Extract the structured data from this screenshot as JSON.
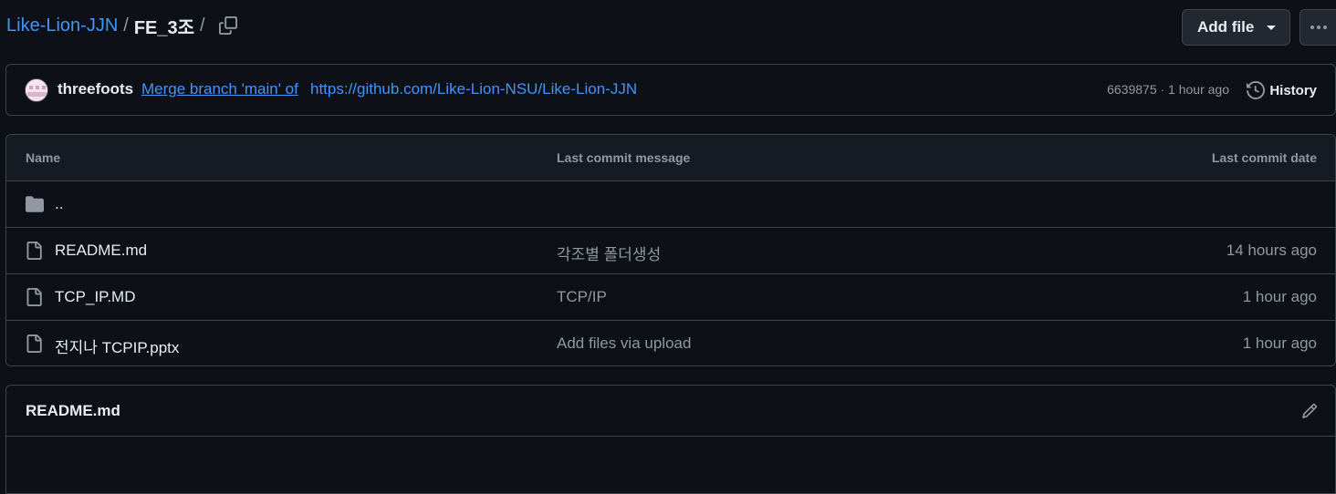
{
  "breadcrumb": {
    "root": "Like-Lion-JJN",
    "separator": "/",
    "current": "FE_3조",
    "trailing_separator": "/"
  },
  "toolbar": {
    "add_file_label": "Add file",
    "more_icon": "kebab-horizontal-icon",
    "copy_icon": "copy-icon"
  },
  "commit": {
    "author": "threefoots",
    "message_link": "Merge branch 'main' of",
    "message_url": "https://github.com/Like-Lion-NSU/Like-Lion-JJN",
    "meta": "6639875 · 1 hour ago",
    "history_label": "History"
  },
  "table": {
    "headers": {
      "name": "Name",
      "message": "Last commit message",
      "date": "Last commit date"
    },
    "rows": [
      {
        "name": "..",
        "message": "",
        "date": "",
        "icon": "folder-icon"
      },
      {
        "name": "README.md",
        "message": "각조별 폴더생성",
        "date": "14 hours ago",
        "icon": "file-icon"
      },
      {
        "name": "TCP_IP.MD",
        "message": "TCP/IP",
        "date": "1 hour ago",
        "icon": "file-icon"
      },
      {
        "name": "전지나 TCPIP.pptx",
        "message": "Add files via upload",
        "date": "1 hour ago",
        "icon": "file-icon"
      }
    ]
  },
  "readme": {
    "title": "README.md",
    "edit_icon": "pencil-icon"
  },
  "colors": {
    "background": "#0d1117",
    "header_bg": "#151b23",
    "border": "#3d444d",
    "link": "#4493f8",
    "text": "#e6edf3",
    "muted": "#9198a1"
  }
}
